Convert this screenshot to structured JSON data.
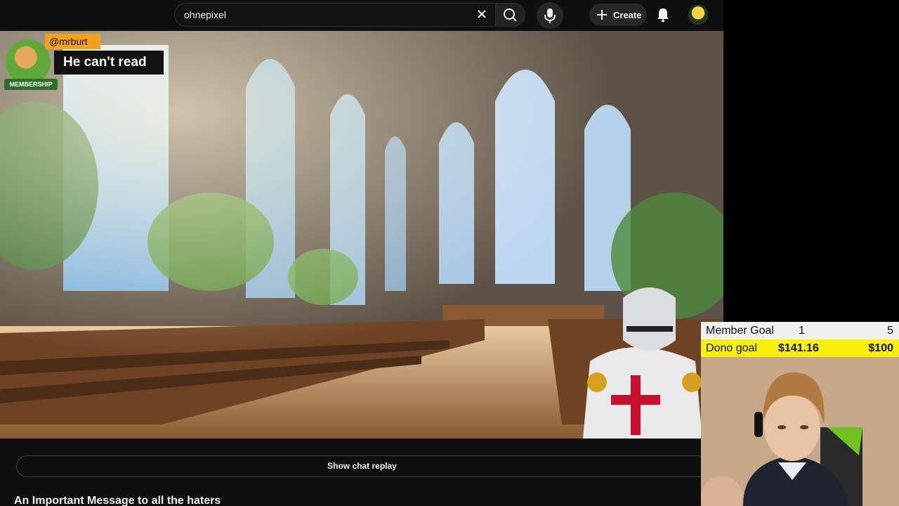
{
  "topbar": {
    "search_value": "ohnepixel",
    "create_label": "Create"
  },
  "chat_overlay": {
    "username": "@mrburt",
    "message": "He can't read",
    "badge_label": "MEMBERSHIP"
  },
  "player": {
    "show_chat_replay_label": "Show chat replay"
  },
  "video": {
    "title": "An Important Message to all the haters"
  },
  "goals": {
    "member_goal": {
      "label": "Member Goal",
      "current": "1",
      "target": "5"
    },
    "dono_goal": {
      "label": "Dono goal",
      "current": "$141.16",
      "target": "$100"
    }
  },
  "colors": {
    "page_bg": "#0f0f0f",
    "chat_username_bg": "#f4a21a",
    "dono_goal_bg": "#f6f00a",
    "member_goal_bg": "#f0f0f0"
  }
}
